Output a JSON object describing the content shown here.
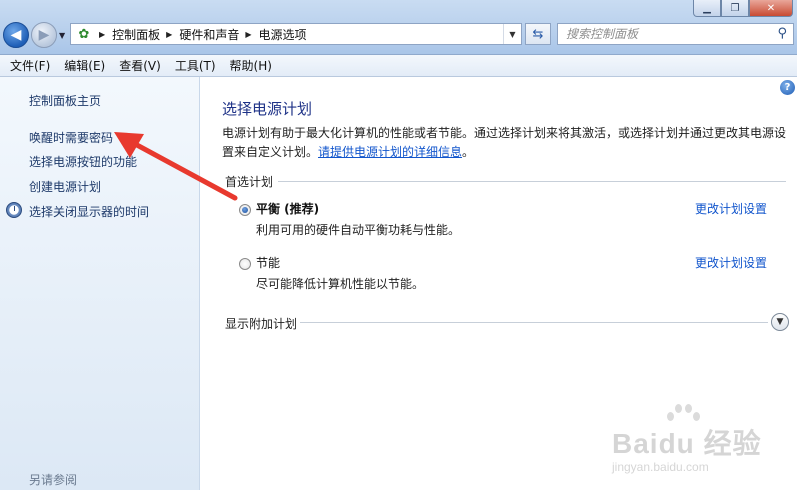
{
  "window": {
    "min_glyph": "▁",
    "max_glyph": "❐",
    "close_glyph": "✕"
  },
  "address": {
    "breadcrumbs": [
      "控制面板",
      "硬件和声音",
      "电源选项"
    ]
  },
  "search": {
    "placeholder": "搜索控制面板"
  },
  "menu": {
    "items": [
      "文件(F)",
      "编辑(E)",
      "查看(V)",
      "工具(T)",
      "帮助(H)"
    ]
  },
  "sidebar": {
    "home": "控制面板主页",
    "links": [
      "唤醒时需要密码",
      "选择电源按钮的功能",
      "创建电源计划",
      "选择关闭显示器的时间"
    ],
    "see_also": "另请参阅"
  },
  "main": {
    "title": "选择电源计划",
    "description": "电源计划有助于最大化计算机的性能或者节能。通过选择计划来将其激活，或选择计划并通过更改其电源设置来自定义计划。",
    "description_link": "请提供电源计划的详细信息",
    "description_end": "。",
    "preferred_heading": "首选计划",
    "plans": [
      {
        "name": "平衡 (推荐)",
        "desc": "利用可用的硬件自动平衡功耗与性能。",
        "link": "更改计划设置",
        "selected": true
      },
      {
        "name": "节能",
        "desc": "尽可能降低计算机性能以节能。",
        "link": "更改计划设置",
        "selected": false
      }
    ],
    "extra_heading": "显示附加计划"
  },
  "watermark": {
    "brand": "Bai",
    "brand2": "du",
    "brand_cn": "经验",
    "url": "jingyan.baidu.com"
  },
  "colors": {
    "link": "#1155cc",
    "title": "#1e3287",
    "annotation_arrow": "#e8392e"
  }
}
